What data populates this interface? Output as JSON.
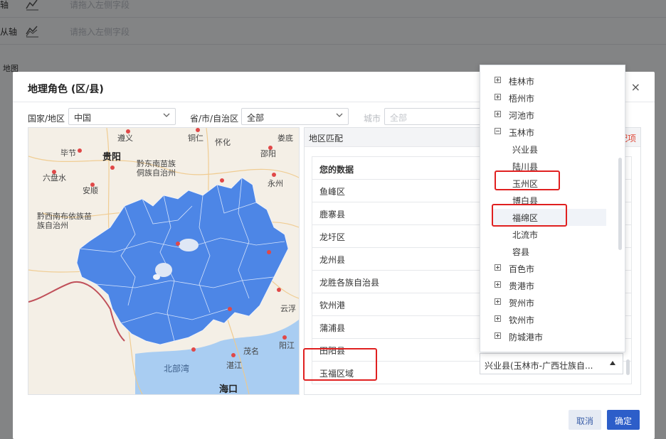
{
  "background": {
    "row1_label": "轴",
    "row1_placeholder": "请拖入左侧字段",
    "row2_label": "从轴",
    "row2_placeholder": "请拖入左侧字段",
    "map_label": "地图"
  },
  "dialog": {
    "title": "地理角色 (区/县)",
    "close": "×",
    "country_label": "国家/地区",
    "country_value": "中国",
    "province_label": "省/市/自治区",
    "province_value": "全部",
    "city_label": "城市",
    "city_value": "全部"
  },
  "map": {
    "cities": [
      "遵义",
      "铜仁",
      "怀化",
      "娄底",
      "毕节",
      "贵阳",
      "邵阳",
      "黔东南苗族侗族自治州",
      "六盘水",
      "安顺",
      "永州",
      "黔西南布依族苗族自治州",
      "云浮",
      "茂名",
      "阳江",
      "北部湾",
      "湛江",
      "海口"
    ],
    "colors": {
      "region": "#4d86e6",
      "land": "#f4efe6",
      "sea": "#a9cdf2",
      "border": "#c0505a"
    }
  },
  "match_panel": {
    "title": "地区匹配",
    "right_hint": "配项",
    "column_header": "您的数据",
    "rows": [
      "鱼峰区",
      "鹿寨县",
      "龙圩区",
      "龙州县",
      "龙胜各族自治县",
      "钦州港",
      "蒲浦县",
      "田阳县",
      "玉福区域"
    ],
    "selected_value": "兴业县(玉林市-广西壮族自..."
  },
  "tree": {
    "items": [
      {
        "label": "桂林市",
        "type": "parent",
        "expanded": false
      },
      {
        "label": "梧州市",
        "type": "parent",
        "expanded": false
      },
      {
        "label": "河池市",
        "type": "parent",
        "expanded": false
      },
      {
        "label": "玉林市",
        "type": "parent",
        "expanded": true
      },
      {
        "label": "兴业县",
        "type": "child"
      },
      {
        "label": "陆川县",
        "type": "child"
      },
      {
        "label": "玉州区",
        "type": "child"
      },
      {
        "label": "博白县",
        "type": "child"
      },
      {
        "label": "福绵区",
        "type": "child",
        "highlighted": true
      },
      {
        "label": "北流市",
        "type": "child"
      },
      {
        "label": "容县",
        "type": "child"
      },
      {
        "label": "百色市",
        "type": "parent",
        "expanded": false
      },
      {
        "label": "贵港市",
        "type": "parent",
        "expanded": false
      },
      {
        "label": "贺州市",
        "type": "parent",
        "expanded": false
      },
      {
        "label": "钦州市",
        "type": "parent",
        "expanded": false
      },
      {
        "label": "防城港市",
        "type": "parent",
        "expanded": false
      }
    ]
  },
  "buttons": {
    "cancel": "取消",
    "ok": "确定"
  },
  "annotation_color": "#e02020"
}
